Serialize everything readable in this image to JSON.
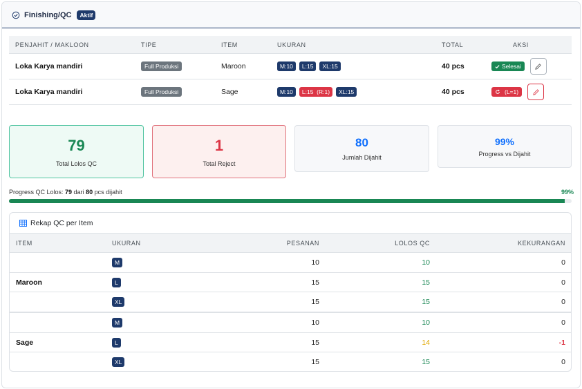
{
  "header": {
    "title": "Finishing/QC",
    "badge": "Aktif"
  },
  "table": {
    "columns": [
      "PENJAHIT / MAKLOON",
      "TIPE",
      "ITEM",
      "UKURAN",
      "TOTAL",
      "AKSI"
    ],
    "rows": [
      {
        "penjahit": "Loka Karya mandiri",
        "tipe": "Full Produksi",
        "item": "Maroon",
        "sizes": [
          {
            "label": "M:10",
            "color": "#1e3a6b"
          },
          {
            "label": "L:15",
            "color": "#1e3a6b"
          },
          {
            "label": "XL:15",
            "color": "#1e3a6b"
          }
        ],
        "total": "40 pcs",
        "status": "Selesai",
        "status_color": "#198754"
      },
      {
        "penjahit": "Loka Karya mandiri",
        "tipe": "Full Produksi",
        "item": "Sage",
        "sizes": [
          {
            "label": "M:10",
            "color": "#1e3a6b"
          },
          {
            "label": "L:15  (R:1)",
            "color": "#dc3545"
          },
          {
            "label": "XL:15",
            "color": "#1e3a6b"
          }
        ],
        "total": "40 pcs",
        "status": "(L=1)",
        "status_color": "#dc3545"
      }
    ]
  },
  "stats": {
    "lolos": {
      "value": "79",
      "label": "Total Lolos QC"
    },
    "reject": {
      "value": "1",
      "label": "Total Reject"
    },
    "dijahit": {
      "value": "80",
      "label": "Jumlah Dijahit"
    },
    "progress": {
      "value": "99%",
      "label": "Progress vs Dijahit"
    }
  },
  "progress": {
    "prefix": "Progress QC Lolos: ",
    "lolos": "79",
    "mid": " dari ",
    "total": "80",
    "suffix": " pcs dijahit",
    "percent_label": "99%",
    "fraction": 0.9875
  },
  "rekap": {
    "title": "Rekap QC per Item",
    "columns": [
      "ITEM",
      "UKURAN",
      "PESANAN",
      "LOLOS QC",
      "KEKURANGAN"
    ],
    "groups": [
      {
        "item": "Maroon",
        "rows": [
          {
            "ukuran": "M",
            "pesanan": "10",
            "lolos": "10",
            "lolos_color": "green",
            "kurang": "0"
          },
          {
            "ukuran": "L",
            "pesanan": "15",
            "lolos": "15",
            "lolos_color": "green",
            "kurang": "0"
          },
          {
            "ukuran": "XL",
            "pesanan": "15",
            "lolos": "15",
            "lolos_color": "green",
            "kurang": "0"
          }
        ]
      },
      {
        "item": "Sage",
        "rows": [
          {
            "ukuran": "M",
            "pesanan": "10",
            "lolos": "10",
            "lolos_color": "green",
            "kurang": "0"
          },
          {
            "ukuran": "L",
            "pesanan": "15",
            "lolos": "14",
            "lolos_color": "yellow",
            "kurang": "-1"
          },
          {
            "ukuran": "XL",
            "pesanan": "15",
            "lolos": "15",
            "lolos_color": "green",
            "kurang": "0"
          }
        ]
      }
    ]
  }
}
